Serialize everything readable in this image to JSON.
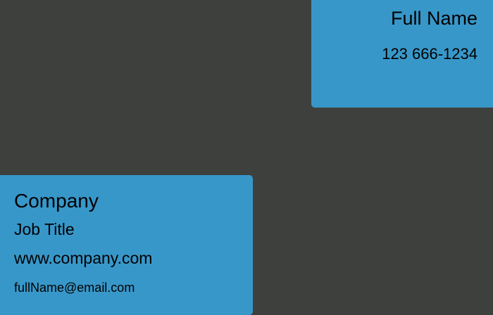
{
  "colors": {
    "background": "#3e403d",
    "card": "#3897c9",
    "text": "#000000"
  },
  "contact_card": {
    "full_name": "Full Name",
    "phone": "123 666-1234"
  },
  "company_card": {
    "company": "Company",
    "job_title": "Job Title",
    "website": "www.company.com",
    "email": "fullName@email.com"
  }
}
